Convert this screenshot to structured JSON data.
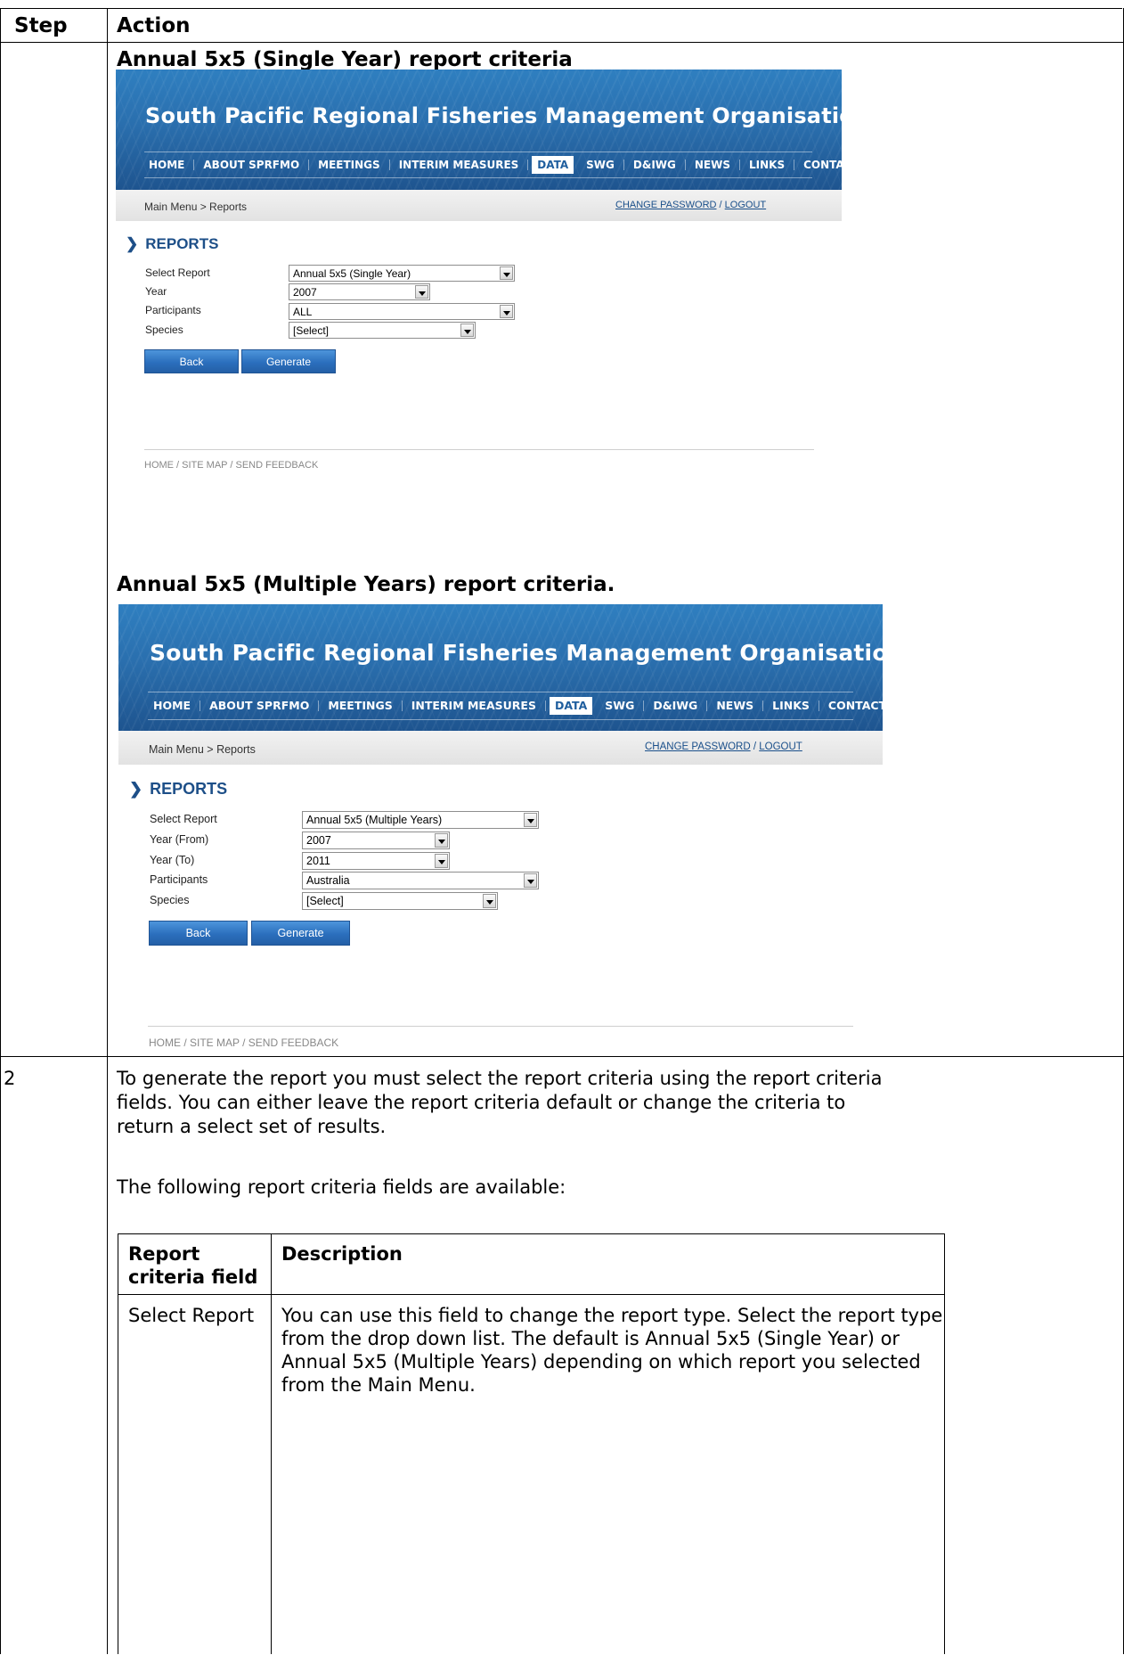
{
  "table": {
    "header": {
      "step": "Step",
      "action": "Action"
    }
  },
  "captions": {
    "single": "Annual 5x5 (Single Year) report criteria",
    "multiple": "Annual 5x5 (Multiple Years) report criteria."
  },
  "site": {
    "org_title": "South Pacific Regional Fisheries Management Organisation",
    "nav": [
      "HOME",
      "ABOUT SPRFMO",
      "MEETINGS",
      "INTERIM MEASURES",
      "DATA",
      "SWG",
      "D&IWG",
      "NEWS",
      "LINKS",
      "CONTACTS"
    ],
    "active_nav": "DATA",
    "breadcrumb": "Main Menu > Reports",
    "change_password": "CHANGE PASSWORD",
    "separator": "/",
    "logout": "LOGOUT",
    "section_title": "REPORTS",
    "back_label": "Back",
    "generate_label": "Generate",
    "footer": "HOME / SITE MAP / SEND FEEDBACK"
  },
  "single_form": {
    "select_report_label": "Select Report",
    "select_report_value": "Annual 5x5 (Single Year)",
    "year_label": "Year",
    "year_value": "2007",
    "participants_label": "Participants",
    "participants_value": "ALL",
    "species_label": "Species",
    "species_value": "[Select]"
  },
  "multi_form": {
    "select_report_label": "Select Report",
    "select_report_value": "Annual 5x5 (Multiple Years)",
    "year_from_label": "Year (From)",
    "year_from_value": "2007",
    "year_to_label": "Year (To)",
    "year_to_value": "2011",
    "participants_label": "Participants",
    "participants_value": "Australia",
    "species_label": "Species",
    "species_value": "[Select]"
  },
  "step2": {
    "number": "2",
    "line1": "To generate the report you must select the report criteria using the report criteria",
    "line2": "fields.  You can either leave the report criteria default or change the criteria to",
    "line3": "return a select set of results.",
    "available": "The following report criteria fields are available:",
    "col_field_line1": "Report",
    "col_field_line2": "criteria field",
    "col_desc": "Description",
    "row1_field": "Select Report",
    "row1_desc": [
      "You can use this field to change the report type. Select the report type",
      "from the drop down list. The default is Annual 5x5 (Single Year) or",
      "Annual 5x5 (Multiple Years) depending on which report you selected",
      "from the Main Menu."
    ]
  }
}
